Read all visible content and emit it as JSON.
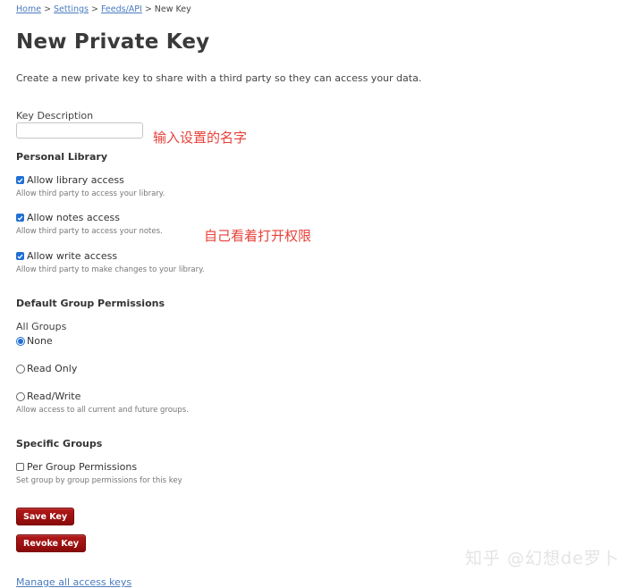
{
  "breadcrumb": {
    "items": [
      {
        "label": "Home",
        "link": true
      },
      {
        "label": "Settings",
        "link": true
      },
      {
        "label": "Feeds/API",
        "link": true
      },
      {
        "label": "New Key",
        "link": false
      }
    ],
    "separator": ">"
  },
  "page": {
    "title": "New Private Key",
    "intro": "Create a new private key to share with a third party so they can access your data."
  },
  "key_description": {
    "label": "Key Description",
    "value": "",
    "placeholder": ""
  },
  "personal_library": {
    "heading": "Personal Library",
    "options": [
      {
        "label": "Allow library access",
        "help": "Allow third party to access your library.",
        "checked": true
      },
      {
        "label": "Allow notes access",
        "help": "Allow third party to access your notes.",
        "checked": true
      },
      {
        "label": "Allow write access",
        "help": "Allow third party to make changes to your library.",
        "checked": true
      }
    ]
  },
  "default_group_permissions": {
    "heading": "Default Group Permissions",
    "group_label": "All Groups",
    "options": [
      {
        "label": "None",
        "selected": true
      },
      {
        "label": "Read Only",
        "selected": false
      },
      {
        "label": "Read/Write",
        "selected": false
      }
    ],
    "help": "Allow access to all current and future groups."
  },
  "specific_groups": {
    "heading": "Specific Groups",
    "option": {
      "label": "Per Group Permissions",
      "checked": false
    },
    "help": "Set group by group permissions for this key"
  },
  "buttons": {
    "save": "Save Key",
    "revoke": "Revoke Key"
  },
  "manage_link": "Manage all access keys",
  "annotations": {
    "name_hint": "输入设置的名字",
    "permission_hint": "自己看着打开权限"
  },
  "watermark": "知乎 @幻想de罗卜",
  "colors": {
    "link": "#4a7bc0",
    "button": "#9e1010",
    "annotation": "#e8413a",
    "checkbox_accent": "#1f6fd6"
  }
}
